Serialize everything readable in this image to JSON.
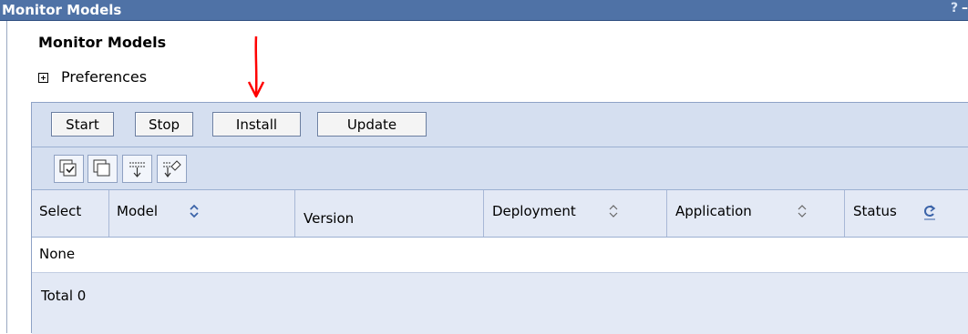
{
  "window": {
    "title": "Monitor Models",
    "help_glyph": "?",
    "minimize_glyph": "–"
  },
  "page": {
    "heading": "Monitor Models",
    "preferences_label": "Preferences"
  },
  "buttons": [
    {
      "label": "Start"
    },
    {
      "label": "Stop"
    },
    {
      "label": "Install"
    },
    {
      "label": "Update"
    }
  ],
  "toolbar_icons": [
    {
      "name": "select-all-icon"
    },
    {
      "name": "deselect-all-icon"
    },
    {
      "name": "show-filter-icon"
    },
    {
      "name": "clear-filter-icon"
    }
  ],
  "table": {
    "columns": [
      {
        "label": "Select",
        "sortable": false
      },
      {
        "label": "Model",
        "sortable": true
      },
      {
        "label": "Version",
        "sortable": false
      },
      {
        "label": "Deployment",
        "sortable": true
      },
      {
        "label": "Application",
        "sortable": true
      },
      {
        "label": "Status",
        "sortable": false,
        "refresh": true
      }
    ],
    "empty_text": "None",
    "total_text": "Total 0"
  },
  "annotation": {
    "arrow_color": "#ff0000"
  },
  "colors": {
    "title_bar": "#4f72a6",
    "panel_bg": "#d5dff0",
    "table_header_bg": "#e3e9f5",
    "sort_arrow": "#3b63a8"
  }
}
